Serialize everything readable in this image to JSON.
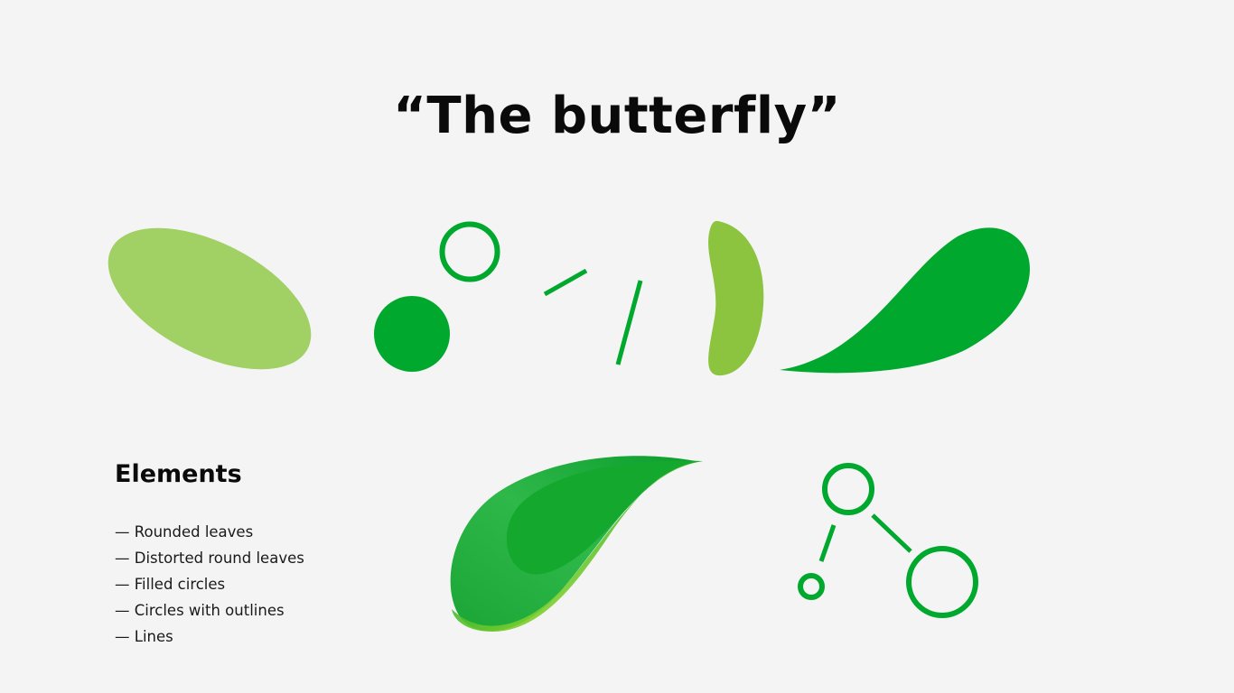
{
  "slide": {
    "title": "“The butterfly”",
    "elements_heading": "Elements",
    "elements_list": [
      "— Rounded leaves",
      "— Distorted round leaves",
      "— Filled circles",
      "— Circles with outlines",
      "— Lines"
    ]
  },
  "colors": {
    "background": "#f4f4f4",
    "light_green": "#a1d065",
    "mid_green": "#8cc43f",
    "brand_green": "#00a82d",
    "lime": "#c4ea2e",
    "text": "#0a0a0a"
  }
}
